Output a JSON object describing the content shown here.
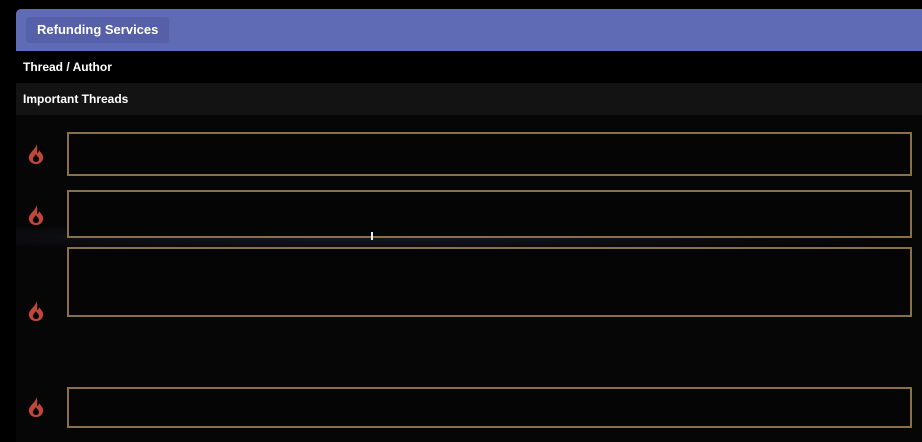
{
  "header": {
    "category_label": "Refunding Services"
  },
  "columns": {
    "label": "Thread / Author"
  },
  "section": {
    "title": "Important Threads"
  },
  "colors": {
    "header_bg": "#606bb5",
    "flame": "#c0463a",
    "thread_border": "#8a7048"
  },
  "threads": [
    {
      "icon": "flame-icon"
    },
    {
      "icon": "flame-icon"
    },
    {
      "icon": "flame-icon"
    },
    {
      "icon": "flame-icon"
    }
  ]
}
